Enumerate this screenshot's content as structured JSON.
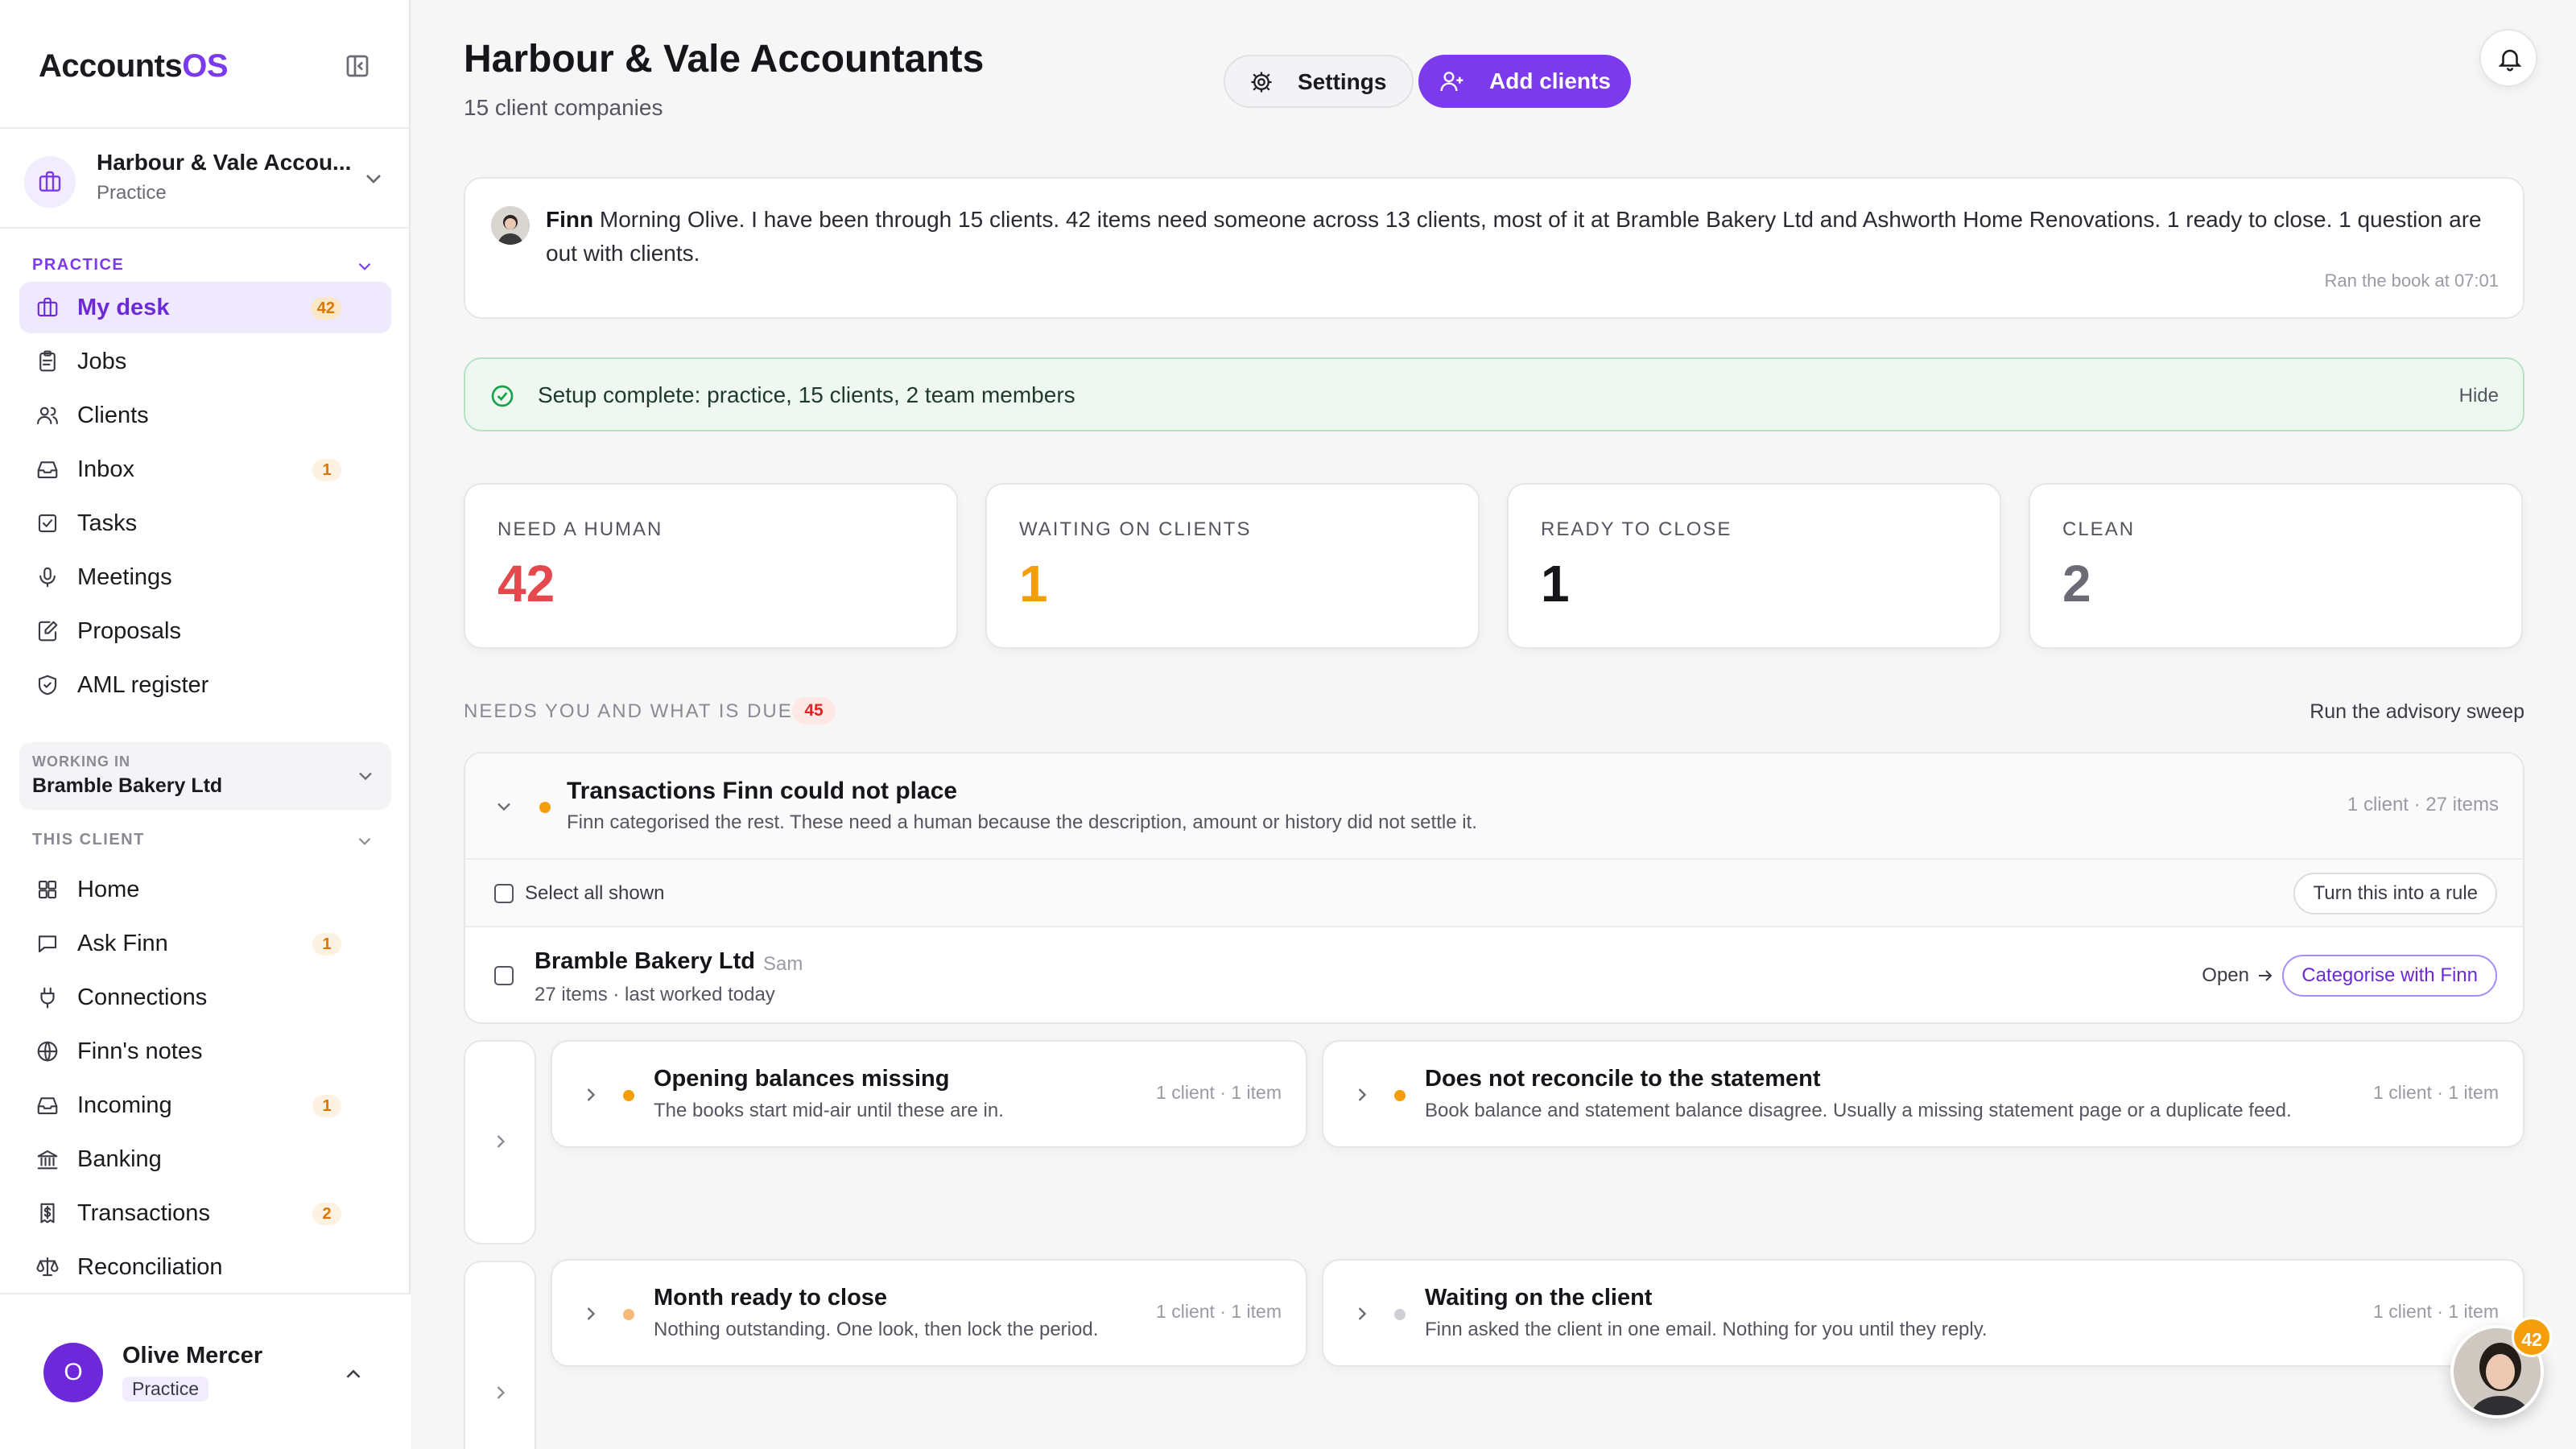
{
  "app": {
    "logo_main": "Accounts",
    "logo_accent": "OS"
  },
  "practice": {
    "name": "Harbour & Vale Accou...",
    "role": "Practice"
  },
  "sidebar": {
    "practice_section": "PRACTICE",
    "practice_items": [
      {
        "label": "My desk",
        "icon": "briefcase-icon",
        "count": "42"
      },
      {
        "label": "Jobs",
        "icon": "clipboard-icon",
        "count": ""
      },
      {
        "label": "Clients",
        "icon": "users-icon",
        "count": ""
      },
      {
        "label": "Inbox",
        "icon": "inbox-icon",
        "count": "1"
      },
      {
        "label": "Tasks",
        "icon": "checkbox-icon",
        "count": ""
      },
      {
        "label": "Meetings",
        "icon": "microphone-icon",
        "count": ""
      },
      {
        "label": "Proposals",
        "icon": "document-edit-icon",
        "count": ""
      },
      {
        "label": "AML register",
        "icon": "shield-icon",
        "count": ""
      }
    ],
    "working_in_label": "WORKING IN",
    "working_in_value": "Bramble Bakery Ltd",
    "client_section": "THIS CLIENT",
    "client_items": [
      {
        "label": "Home",
        "icon": "grid-icon",
        "count": ""
      },
      {
        "label": "Ask Finn",
        "icon": "chat-icon",
        "count": "1"
      },
      {
        "label": "Connections",
        "icon": "plug-icon",
        "count": ""
      },
      {
        "label": "Finn's notes",
        "icon": "globe-icon",
        "count": ""
      },
      {
        "label": "Incoming",
        "icon": "inbox-icon",
        "count": "1"
      },
      {
        "label": "Banking",
        "icon": "bank-icon",
        "count": ""
      },
      {
        "label": "Transactions",
        "icon": "receipt-icon",
        "count": "2"
      },
      {
        "label": "Reconciliation",
        "icon": "scale-icon",
        "count": ""
      }
    ]
  },
  "user": {
    "initial": "O",
    "name": "Olive Mercer",
    "role": "Practice"
  },
  "header": {
    "title": "Harbour & Vale Accountants",
    "subtitle": "15 client companies",
    "settings_label": "Settings",
    "add_clients_label": "Add clients"
  },
  "finn_message": {
    "sender": "Finn",
    "text": "Morning Olive. I have been through 15 clients. 42 items need someone across 13 clients, most of it at Bramble Bakery Ltd and Ashworth Home Renovations. 1 ready to close. 1 question are out with clients.",
    "ran_at": "Ran the book at 07:01"
  },
  "setup": {
    "text": "Setup complete: practice, 15 clients, 2 team members",
    "hide_label": "Hide"
  },
  "stats": [
    {
      "label": "NEED A HUMAN",
      "value": "42",
      "color": "#e5484d"
    },
    {
      "label": "WAITING ON CLIENTS",
      "value": "1",
      "color": "#f59e0b"
    },
    {
      "label": "READY TO CLOSE",
      "value": "1",
      "color": "#15151a"
    },
    {
      "label": "CLEAN",
      "value": "2",
      "color": "#6b6b76"
    }
  ],
  "due_section": {
    "title": "NEEDS YOU AND WHAT IS DUE",
    "count": "45",
    "sweep_label": "Run the advisory sweep"
  },
  "group": {
    "title": "Transactions Finn could not place",
    "description": "Finn categorised the rest. These need a human because the description, amount or history did not settle it.",
    "meta": "1 client · 27 items",
    "select_all_label": "Select all shown",
    "rule_button": "Turn this into a rule",
    "client": {
      "name": "Bramble Bakery Ltd",
      "owner": "Sam",
      "meta": "27 items · last worked today",
      "open_label": "Open",
      "action_label": "Categorise with Finn"
    }
  },
  "cards": [
    {
      "title": "Opening balances missing",
      "desc": "The books start mid-air until these are in.",
      "meta": "1 client · 1 item",
      "dot": "#f59e0b"
    },
    {
      "title": "Does not reconcile to the statement",
      "desc": "Book balance and statement balance disagree. Usually a missing statement page or a duplicate feed.",
      "meta": "1 client · 1 item",
      "dot": "#f59e0b"
    },
    {
      "title": "Month ready to close",
      "desc": "Nothing outstanding. One look, then lock the period.",
      "meta": "1 client · 1 item",
      "dot": "#f7b97a"
    },
    {
      "title": "Waiting on the client",
      "desc": "Finn asked the client in one email. Nothing for you until they reply.",
      "meta": "1 client · 1 item",
      "dot": "#cfcfd6"
    }
  ],
  "finn_bubble_count": "42",
  "colors": {
    "accent": "#7c3aed",
    "warning": "#f59e0b",
    "danger": "#e5484d",
    "success_bg": "#eef8f1"
  }
}
